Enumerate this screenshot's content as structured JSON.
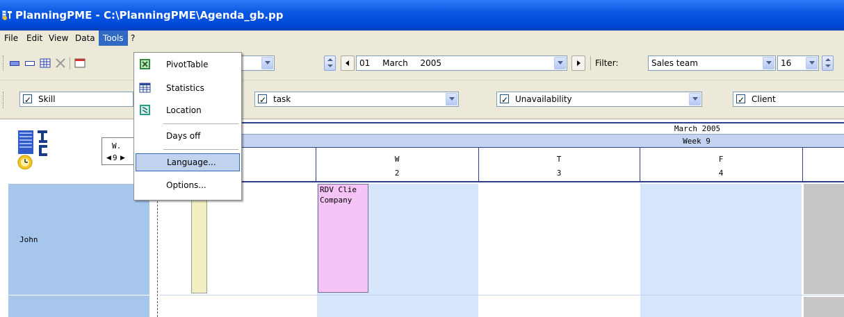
{
  "window": {
    "title": "PlanningPME - C:\\PlanningPME\\Agenda_gb.pp"
  },
  "menubar": {
    "items": [
      "File",
      "Edit",
      "View",
      "Data",
      "Tools",
      "?"
    ],
    "active": "Tools"
  },
  "tools_menu": {
    "items": [
      {
        "label": "PivotTable",
        "icon": "excel-icon"
      },
      {
        "label": "Statistics",
        "icon": "table-icon"
      },
      {
        "label": "Location",
        "icon": "map-icon"
      },
      {
        "label": "Days off",
        "icon": ""
      },
      {
        "label": "Language...",
        "icon": "",
        "highlighted": true
      },
      {
        "label": "Options...",
        "icon": ""
      }
    ]
  },
  "toolbar1": {
    "date": {
      "day": "01",
      "month": "March",
      "year": "2005"
    },
    "filter_label": "Filter:",
    "filter_value": "Sales team",
    "number_value": "16"
  },
  "toolbar2": {
    "filters": [
      {
        "label": "Skill",
        "checked": true
      },
      {
        "label": "task",
        "checked": true
      },
      {
        "label": "Unavailability",
        "checked": true
      },
      {
        "label": "Client",
        "checked": true
      }
    ]
  },
  "planner": {
    "week_nav": {
      "top": "W.",
      "value": "9"
    },
    "month_header": "March 2005",
    "week_header": "Week 9",
    "days": [
      {
        "letter": "W",
        "num": "2"
      },
      {
        "letter": "T",
        "num": "3"
      },
      {
        "letter": "F",
        "num": "4"
      }
    ],
    "resources": [
      "John"
    ],
    "appointment": {
      "line1": "RDV Clie",
      "line2": "Company"
    }
  },
  "colors": {
    "title_bar": "#0a58e4",
    "menu_highlight": "#316ac5",
    "resource_bg": "#a6c6ec",
    "weekday_bg": "#d6e6fa",
    "appointment": "#f5c3f5",
    "weekend": "#c6c6c6"
  }
}
